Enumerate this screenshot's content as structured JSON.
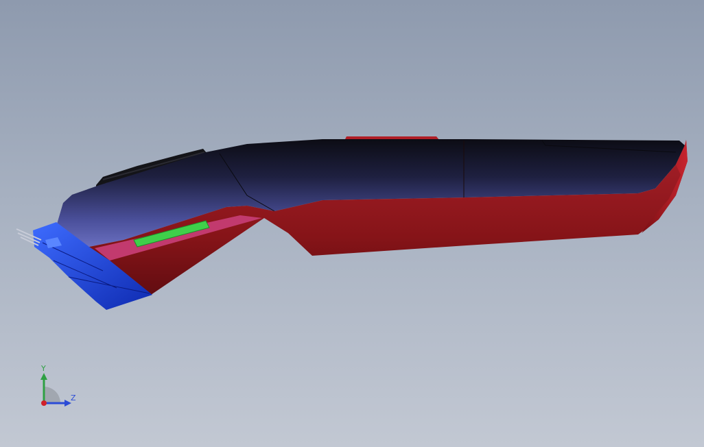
{
  "viewport": {
    "background_top": "#8e9aae",
    "background_bottom": "#c2c8d3"
  },
  "model": {
    "colors": {
      "upper_shell": "#3a3f7a",
      "lower_shell": "#8c1a1c",
      "blade_head": "#1f3fd6",
      "switch_strip": "#c23a6e",
      "switch_button": "#3fd04a",
      "top_button": "#b01e26"
    }
  },
  "triad": {
    "y_label": "Y",
    "z_label": "Z",
    "colors": {
      "y_axis": "#2ea043",
      "z_axis": "#2b4bd6",
      "origin": "#d0202a"
    }
  }
}
